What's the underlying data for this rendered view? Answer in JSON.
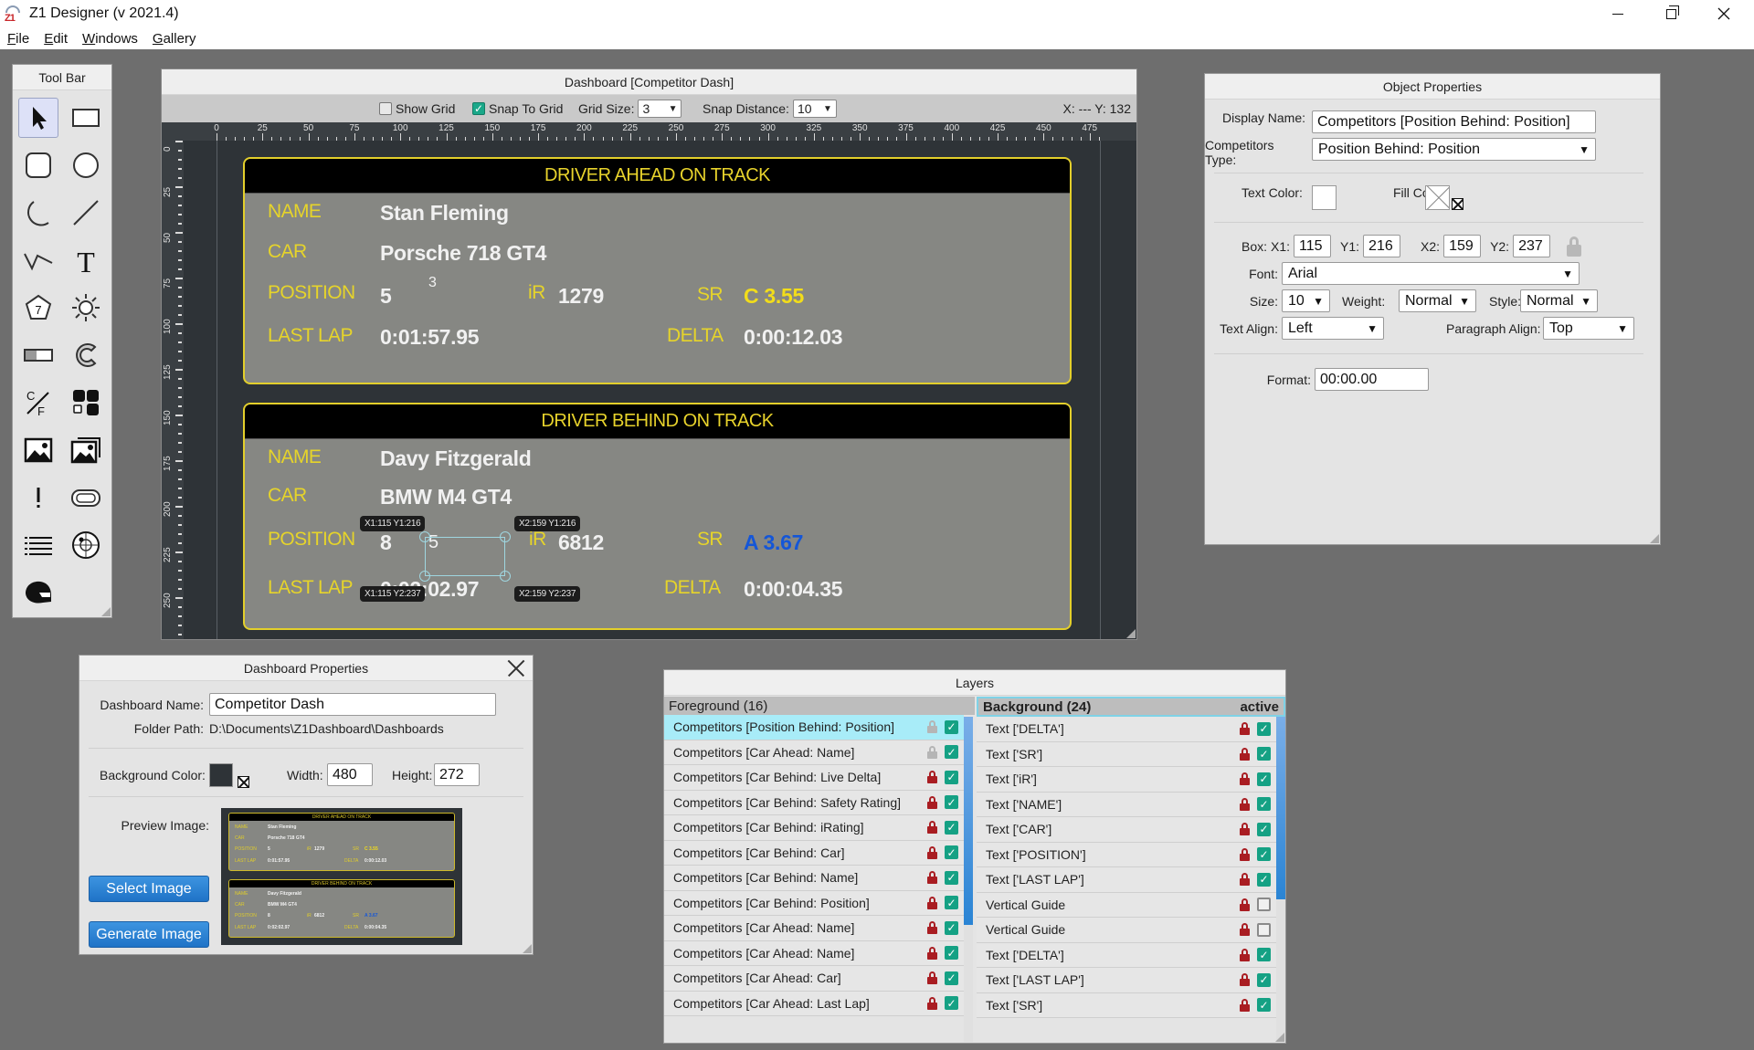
{
  "app": {
    "title": "Z1 Designer (v 2021.4)",
    "logo_text": "Z1",
    "menu": [
      {
        "label": "File",
        "mnemonic": "F",
        "rest": "ile"
      },
      {
        "label": "Edit",
        "mnemonic": "E",
        "rest": "dit"
      },
      {
        "label": "Windows",
        "mnemonic": "W",
        "rest": "indows"
      },
      {
        "label": "Gallery",
        "mnemonic": "G",
        "rest": "allery"
      }
    ]
  },
  "toolbar": {
    "title": "Tool Bar",
    "tools": [
      {
        "name": "select-pointer-icon",
        "active": true
      },
      {
        "name": "rectangle-icon"
      },
      {
        "name": "rounded-rectangle-icon"
      },
      {
        "name": "circle-icon"
      },
      {
        "name": "arc-icon"
      },
      {
        "name": "line-icon"
      },
      {
        "name": "polyline-icon"
      },
      {
        "name": "text-icon"
      },
      {
        "name": "gear-indicator-icon"
      },
      {
        "name": "brightness-icon"
      },
      {
        "name": "progress-bar-icon"
      },
      {
        "name": "arc-gauge-icon"
      },
      {
        "name": "unit-conversion-icon"
      },
      {
        "name": "button-group-icon"
      },
      {
        "name": "image-icon"
      },
      {
        "name": "image-gallery-icon"
      },
      {
        "name": "alert-icon"
      },
      {
        "name": "track-map-icon"
      },
      {
        "name": "list-icon"
      },
      {
        "name": "target-map-icon"
      },
      {
        "name": "helmet-icon"
      }
    ]
  },
  "dashboard_window": {
    "title": "Dashboard [Competitor Dash]",
    "show_grid_label": "Show Grid",
    "show_grid": false,
    "snap_to_grid_label": "Snap To Grid",
    "snap_to_grid": true,
    "grid_size_label": "Grid Size:",
    "grid_size": "3",
    "snap_distance_label": "Snap Distance:",
    "snap_distance": "10",
    "cursor_readout": "X: --- Y: 132",
    "ruler_h_labels": [
      "0",
      "25",
      "50",
      "75",
      "100",
      "125",
      "150",
      "175",
      "200",
      "225",
      "250",
      "275",
      "300",
      "325",
      "350",
      "375",
      "400",
      "425",
      "450",
      "475"
    ],
    "ruler_v_labels": [
      "0",
      "25",
      "50",
      "75",
      "100",
      "125",
      "150",
      "175",
      "200",
      "225",
      "250"
    ]
  },
  "cards": {
    "ahead": {
      "header": "DRIVER AHEAD ON TRACK",
      "name_label": "NAME",
      "name": "Stan Fleming",
      "car_label": "CAR",
      "car": "Porsche 718 GT4",
      "position_label": "POSITION",
      "position": "5",
      "class_position": "3",
      "ir_label": "iR",
      "ir": "1279",
      "sr_label": "SR",
      "sr": "C 3.55",
      "sr_color": "#f2dd1a",
      "lastlap_label": "LAST LAP",
      "lastlap": "0:01:57.95",
      "delta_label": "DELTA",
      "delta": "0:00:12.03"
    },
    "behind": {
      "header": "DRIVER BEHIND ON TRACK",
      "name_label": "NAME",
      "name": "Davy Fitzgerald",
      "car_label": "CAR",
      "car": "BMW M4 GT4",
      "position_label": "POSITION",
      "position": "8",
      "class_position": "5",
      "ir_label": "iR",
      "ir": "6812",
      "sr_label": "SR",
      "sr": "A 3.67",
      "sr_color": "#1456d8",
      "lastlap_label": "LAST LAP",
      "lastlap": "0:02:02.97",
      "delta_label": "DELTA",
      "delta": "0:00:04.35"
    }
  },
  "selection": {
    "tip_tl": "X1:115 Y1:216",
    "tip_tr": "X2:159 Y1:216",
    "tip_bl": "X1:115 Y2:237",
    "tip_br": "X2:159 Y2:237"
  },
  "object_properties": {
    "title": "Object Properties",
    "display_name_label": "Display Name:",
    "display_name": "Competitors [Position Behind: Position]",
    "competitors_type_label": "Competitors Type:",
    "competitors_type": "Position Behind: Position",
    "text_color_label": "Text Color:",
    "text_color": "#ffffff",
    "fill_color_label": "Fill Color:",
    "box_label": "Box:",
    "x1_label": "X1:",
    "x1": "115",
    "y1_label": "Y1:",
    "y1": "216",
    "x2_label": "X2:",
    "x2": "159",
    "y2_label": "Y2:",
    "y2": "237",
    "font_label": "Font:",
    "font": "Arial",
    "size_label": "Size:",
    "size": "10",
    "weight_label": "Weight:",
    "weight": "Normal",
    "style_label": "Style:",
    "style": "Normal",
    "text_align_label": "Text Align:",
    "text_align": "Left",
    "paragraph_align_label": "Paragraph Align:",
    "paragraph_align": "Top",
    "format_label": "Format:",
    "format": "00:00.00"
  },
  "dashboard_properties": {
    "title": "Dashboard Properties",
    "name_label": "Dashboard Name:",
    "name": "Competitor Dash",
    "folder_label": "Folder Path:",
    "folder": "D:\\Documents\\Z1Dashboard\\Dashboards",
    "bg_color_label": "Background Color:",
    "bg_color": "#2e3337",
    "width_label": "Width:",
    "width": "480",
    "height_label": "Height:",
    "height": "272",
    "preview_label": "Preview Image:",
    "select_image": "Select Image",
    "generate_image": "Generate Image"
  },
  "layers": {
    "title": "Layers",
    "foreground_header": "Foreground (16)",
    "background_header": "Background (24)",
    "active_label": "active",
    "foreground": [
      {
        "name": "Competitors [Position Behind: Position]",
        "locked": false,
        "visible": true,
        "selected": true
      },
      {
        "name": "Competitors [Car Ahead: Name]",
        "locked": false,
        "visible": true
      },
      {
        "name": "Competitors [Car Behind: Live Delta]",
        "locked": true,
        "visible": true
      },
      {
        "name": "Competitors [Car Behind: Safety Rating]",
        "locked": true,
        "visible": true
      },
      {
        "name": "Competitors [Car Behind: iRating]",
        "locked": true,
        "visible": true
      },
      {
        "name": "Competitors [Car Behind: Car]",
        "locked": true,
        "visible": true
      },
      {
        "name": "Competitors [Car Behind: Name]",
        "locked": true,
        "visible": true
      },
      {
        "name": "Competitors [Car Behind: Position]",
        "locked": true,
        "visible": true
      },
      {
        "name": "Competitors [Car Ahead: Name]",
        "locked": true,
        "visible": true
      },
      {
        "name": "Competitors [Car Ahead: Name]",
        "locked": true,
        "visible": true
      },
      {
        "name": "Competitors [Car Ahead: Car]",
        "locked": true,
        "visible": true
      },
      {
        "name": "Competitors [Car Ahead: Last Lap]",
        "locked": true,
        "visible": true
      }
    ],
    "background": [
      {
        "name": "Text ['DELTA']",
        "locked": true,
        "visible": true
      },
      {
        "name": "Text ['SR']",
        "locked": true,
        "visible": true
      },
      {
        "name": "Text ['iR']",
        "locked": true,
        "visible": true
      },
      {
        "name": "Text ['NAME']",
        "locked": true,
        "visible": true
      },
      {
        "name": "Text ['CAR']",
        "locked": true,
        "visible": true
      },
      {
        "name": "Text ['POSITION']",
        "locked": true,
        "visible": true
      },
      {
        "name": "Text ['LAST LAP']",
        "locked": true,
        "visible": true
      },
      {
        "name": "Vertical Guide",
        "locked": true,
        "visible": false
      },
      {
        "name": "Vertical Guide",
        "locked": true,
        "visible": false
      },
      {
        "name": "Text ['DELTA']",
        "locked": true,
        "visible": true
      },
      {
        "name": "Text ['LAST LAP']",
        "locked": true,
        "visible": true
      },
      {
        "name": "Text ['SR']",
        "locked": true,
        "visible": true
      }
    ]
  },
  "colors": {
    "accent_yellow": "#e6d42a",
    "check_green": "#15a184",
    "lock_red": "#a91d22",
    "select_blue": "#1f73c7"
  }
}
